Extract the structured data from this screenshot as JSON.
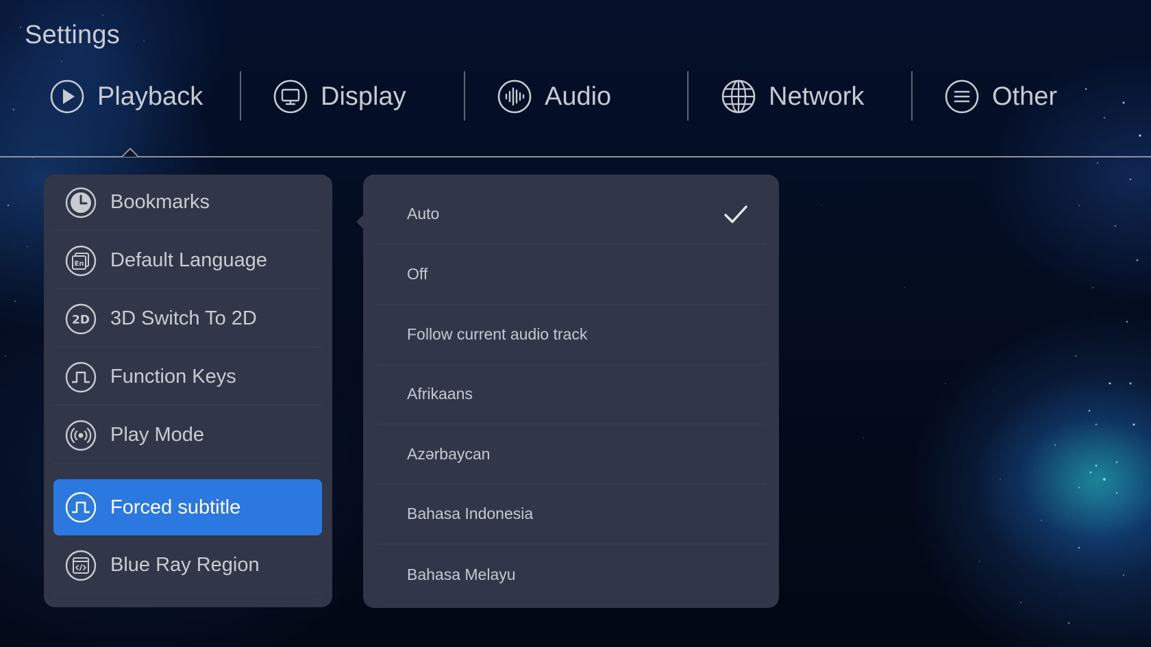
{
  "header": {
    "title": "Settings"
  },
  "tabs": [
    {
      "label": "Playback",
      "icon": "play-circle-icon",
      "selected": true
    },
    {
      "label": "Display",
      "icon": "monitor-icon",
      "selected": false
    },
    {
      "label": "Audio",
      "icon": "waveform-icon",
      "selected": false
    },
    {
      "label": "Network",
      "icon": "globe-icon",
      "selected": false
    },
    {
      "label": "Other",
      "icon": "list-icon",
      "selected": false
    }
  ],
  "menu": {
    "items": [
      {
        "label": "Bookmarks",
        "icon": "clock-icon",
        "active": false
      },
      {
        "label": "Default Language",
        "icon": "language-icon",
        "active": false
      },
      {
        "label": "3D Switch To 2D",
        "icon": "2d-icon",
        "active": false
      },
      {
        "label": "Function Keys",
        "icon": "pulse-icon",
        "active": false
      },
      {
        "label": "Play Mode",
        "icon": "broadcast-icon",
        "active": false
      },
      {
        "label": "Forced subtitle",
        "icon": "pulse-icon",
        "active": true
      },
      {
        "label": "Blue Ray Region",
        "icon": "code-window-icon",
        "active": false
      }
    ]
  },
  "options": {
    "items": [
      {
        "label": "Auto",
        "checked": true
      },
      {
        "label": "Off",
        "checked": false
      },
      {
        "label": "Follow current audio track",
        "checked": false
      },
      {
        "label": "Afrikaans",
        "checked": false
      },
      {
        "label": "Azərbaycan",
        "checked": false
      },
      {
        "label": "Bahasa Indonesia",
        "checked": false
      },
      {
        "label": "Bahasa Melayu",
        "checked": false
      }
    ]
  },
  "colors": {
    "accent": "#2a78e0",
    "panel": "#313748",
    "background": "#040b1c",
    "text": "#c9ccd3"
  }
}
